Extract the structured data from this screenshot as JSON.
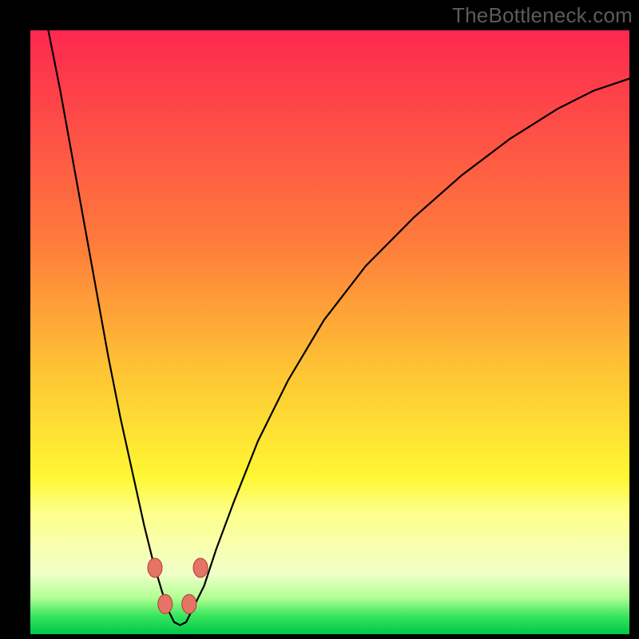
{
  "watermark": {
    "label": "TheBottleneck.com"
  },
  "colors": {
    "bg_black": "#000000",
    "curve": "#000000",
    "marker_fill": "#e57366",
    "marker_stroke": "#b63b2e",
    "grad_top": "#fd2850",
    "grad_mid_upper": "#fe7b3b",
    "grad_mid": "#fec634",
    "grad_mid_lower": "#fef733",
    "grad_plateau": "#fdff8c",
    "grad_pale": "#f1ffc9",
    "grad_green_light": "#b0ff93",
    "grad_green": "#37e55d",
    "grad_green_deep": "#00c74a"
  },
  "chart_data": {
    "type": "line",
    "title": "",
    "xlabel": "",
    "ylabel": "",
    "xlim": [
      0,
      100
    ],
    "ylim": [
      0,
      100
    ],
    "curve": {
      "name": "bottleneck-curve",
      "x": [
        3,
        5,
        7,
        9,
        11,
        13,
        15,
        17,
        19,
        20.5,
        22,
        23,
        24,
        25,
        26,
        27,
        29,
        31,
        34,
        38,
        43,
        49,
        56,
        64,
        72,
        80,
        88,
        94,
        100
      ],
      "y": [
        100,
        90,
        79,
        68,
        57,
        46,
        36,
        27,
        18,
        12,
        7,
        4,
        2,
        1.5,
        2,
        4,
        8,
        14,
        22,
        32,
        42,
        52,
        61,
        69,
        76,
        82,
        87,
        90,
        92
      ]
    },
    "markers": [
      {
        "x": 20.8,
        "y": 11.0
      },
      {
        "x": 22.5,
        "y": 5.0
      },
      {
        "x": 26.5,
        "y": 5.0
      },
      {
        "x": 28.4,
        "y": 11.0
      }
    ],
    "gradient_bands_pct_from_top": [
      {
        "stop": 0,
        "color": "grad_top"
      },
      {
        "stop": 35,
        "color": "grad_mid_upper"
      },
      {
        "stop": 57,
        "color": "grad_mid"
      },
      {
        "stop": 74,
        "color": "grad_mid_lower"
      },
      {
        "stop": 80,
        "color": "grad_plateau"
      },
      {
        "stop": 90,
        "color": "grad_pale"
      },
      {
        "stop": 94,
        "color": "grad_green_light"
      },
      {
        "stop": 97,
        "color": "grad_green"
      },
      {
        "stop": 100,
        "color": "grad_green_deep"
      }
    ]
  }
}
